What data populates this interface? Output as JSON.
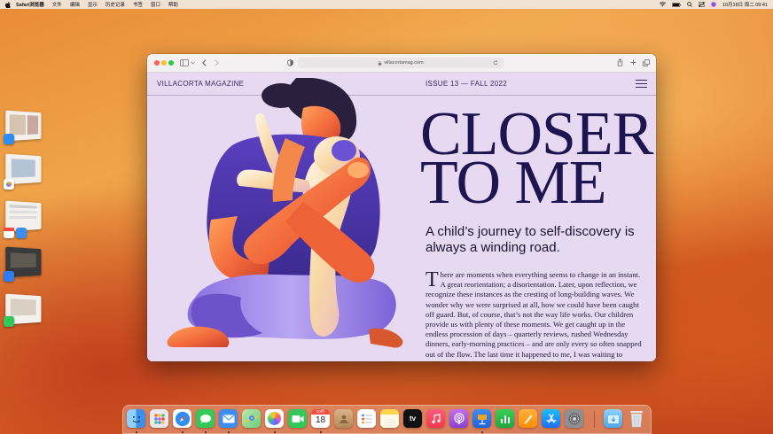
{
  "menubar": {
    "app_name": "Safari浏览器",
    "items": [
      "文件",
      "编辑",
      "显示",
      "历史记录",
      "书签",
      "窗口",
      "帮助"
    ],
    "clock": "10月18日 周二 09:41"
  },
  "browser": {
    "url": "villacortamag.com"
  },
  "site": {
    "brand": "VILLACORTA MAGAZINE",
    "issue": "ISSUE 13 — FALL 2022",
    "headline": "CLOSER\nTO ME",
    "subhead": "A child’s journey to self-discovery is always a winding road.",
    "dropcap": "T",
    "body": "here are moments when everything seems to change in an instant. A great reorientation; a disorientation. Later, upon reflection, we recognize these instances as the cresting of long-building waves. We wonder why we were surprised at all, how we could have been caught off guard. But, of course, that’s not the way life works. Our children provide us with plenty of these moments. We get caught up in the endless procession of days – quarterly reviews, rushed Wednesday dinners, early-morning practices – and are only every so often snapped out of the flow. The last time it happened to me, I was waiting to"
  },
  "dock": {
    "calendar_month": "10月",
    "calendar_day": "18",
    "tv_label": "tv",
    "apps": [
      {
        "name": "finder",
        "color": "#3c9cf0"
      },
      {
        "name": "launchpad",
        "color": "#e9e9ee"
      },
      {
        "name": "safari",
        "color": "#2f8ff0"
      },
      {
        "name": "messages",
        "color": "#34c759"
      },
      {
        "name": "mail",
        "color": "#3b8ef5"
      },
      {
        "name": "maps",
        "color": "#6fcf7c"
      },
      {
        "name": "photos",
        "color": "#ffffff"
      },
      {
        "name": "facetime",
        "color": "#34c759"
      },
      {
        "name": "calendar",
        "color": "#ffffff"
      },
      {
        "name": "contacts",
        "color": "#c6a27a"
      },
      {
        "name": "reminders",
        "color": "#ffffff"
      },
      {
        "name": "notes",
        "color": "#ffd34e"
      },
      {
        "name": "apple-tv",
        "color": "#111111"
      },
      {
        "name": "music",
        "color": "#fa3c5a"
      },
      {
        "name": "podcasts",
        "color": "#a052e0"
      },
      {
        "name": "keynote",
        "color": "#2f7df6"
      },
      {
        "name": "numbers",
        "color": "#2fc14c"
      },
      {
        "name": "pages",
        "color": "#ff9f0a"
      },
      {
        "name": "app-store",
        "color": "#1e8ff7"
      },
      {
        "name": "system-settings",
        "color": "#8e8e93"
      },
      {
        "name": "downloads-folder",
        "color": "#69b7f2"
      },
      {
        "name": "trash",
        "color": "#dfe3e8"
      }
    ]
  }
}
